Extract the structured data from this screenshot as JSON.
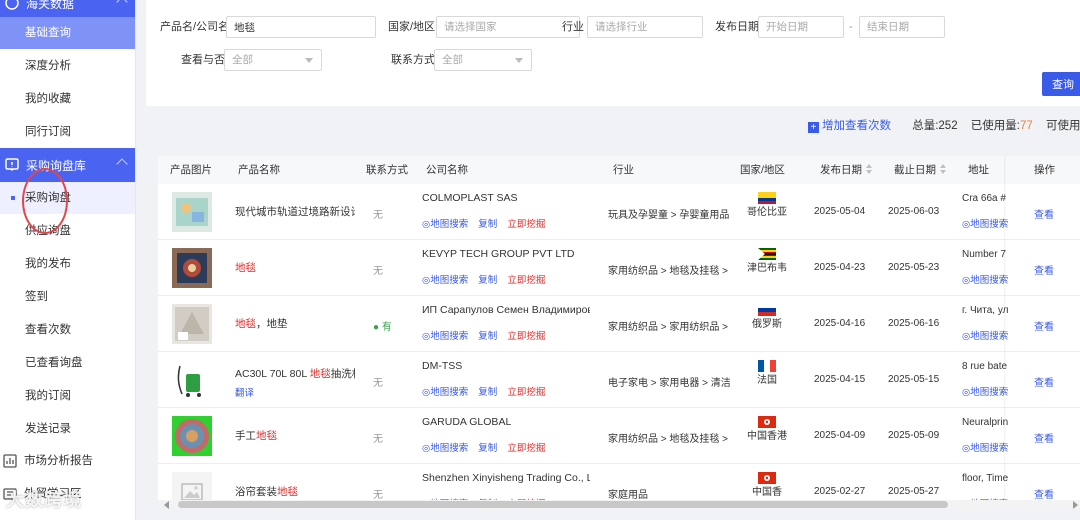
{
  "sidebar": {
    "group_top": "海关数据",
    "items_top": [
      {
        "label": "基础查询",
        "state": "active"
      },
      {
        "label": "深度分析"
      },
      {
        "label": "我的收藏"
      },
      {
        "label": "同行订阅"
      }
    ],
    "group_procurement": "采购询盘库",
    "items_procurement": [
      {
        "label": "采购询盘",
        "state": "current"
      },
      {
        "label": "供应询盘"
      },
      {
        "label": "我的发布"
      },
      {
        "label": "签到"
      },
      {
        "label": "查看次数"
      },
      {
        "label": "已查看询盘"
      },
      {
        "label": "我的订阅"
      },
      {
        "label": "发送记录"
      }
    ],
    "main_market_report": "市场分析报告",
    "main_learning": "外贸学习区"
  },
  "filters": {
    "product_label": "产品名/公司名",
    "product_value": "地毯",
    "country_label": "国家/地区",
    "country_placeholder": "请选择国家",
    "industry_label": "行业",
    "industry_placeholder": "请选择行业",
    "date_label": "发布日期",
    "start_placeholder": "开始日期",
    "date_sep": "-",
    "end_placeholder": "结束日期",
    "viewed_label": "查看与否",
    "viewed_value": "全部",
    "contact_label": "联系方式",
    "contact_value": "全部",
    "query_button": "查询"
  },
  "stats": {
    "add_views": "增加查看次数",
    "total_label": "总量:",
    "total_value": "252",
    "used_label": "已使用量:",
    "used_value": "77",
    "available_label": "可使用量:"
  },
  "table": {
    "headers": {
      "image": "产品图片",
      "name": "产品名称",
      "contact": "联系方式",
      "company": "公司名称",
      "industry": "行业",
      "country": "国家/地区",
      "publish_date": "发布日期",
      "deadline": "截止日期",
      "address": "地址",
      "ops": "操作"
    },
    "action_labels": {
      "map": "◎地图搜索",
      "copy": "复制",
      "dig": "立即挖掘",
      "view": "查看"
    },
    "rows": [
      {
        "name_pre": "现代城市轨道过境路新设计",
        "name_hl": "",
        "name_post": "",
        "contact": "无",
        "company": "COLMOPLAST SAS",
        "industry": "玩具及孕婴童 > 孕婴童用品",
        "country": "哥伦比亚",
        "publish": "2025-05-04",
        "deadline": "2025-06-03",
        "address": "Cra 66a #",
        "thumb": "toy"
      },
      {
        "name_pre": "",
        "name_hl": "地毯",
        "name_post": "",
        "contact": "无",
        "company": "KEVYP TECH GROUP PVT LTD",
        "industry": "家用纺织品 > 地毯及挂毯 > 地",
        "country": "津巴布韦",
        "publish": "2025-04-23",
        "deadline": "2025-05-23",
        "address": "Number 7",
        "thumb": "rug"
      },
      {
        "name_pre": "",
        "name_hl": "地毯",
        "name_post": "，地垫",
        "contact": "有",
        "company": "ИП Сарапулов Семен Владимирович",
        "industry": "家用纺织品 > 家用纺织品 > 地",
        "country": "俄罗斯",
        "publish": "2025-04-16",
        "deadline": "2025-06-16",
        "address": "г. Чита, ул",
        "thumb": "mat"
      },
      {
        "name_pre": "AC30L 70L 80L ",
        "name_hl": "地毯",
        "name_post": "抽洗机",
        "translate": "翻译",
        "contact": "无",
        "company": "DM-TSS",
        "industry": "电子家电 > 家用电器 > 清洁",
        "country": "法国",
        "publish": "2025-04-15",
        "deadline": "2025-05-15",
        "address": "8 rue bate",
        "thumb": "vacuum"
      },
      {
        "name_pre": "手工",
        "name_hl": "地毯",
        "name_post": "",
        "contact": "无",
        "company": "GARUDA GLOBAL",
        "industry": "家用纺织品 > 地毯及挂毯 > 地",
        "country": "中国香港",
        "publish": "2025-04-09",
        "deadline": "2025-05-09",
        "address": "Neuralprin",
        "thumb": "round"
      },
      {
        "name_pre": "浴帘套装",
        "name_hl": "地毯",
        "name_post": "",
        "contact": "无",
        "company": "Shenzhen Xinyisheng Trading Co., Ltd.",
        "industry": "家庭用品",
        "country": "中国香",
        "publish": "2025-02-27",
        "deadline": "2025-05-27",
        "address": "floor, Time",
        "thumb": "placeholder"
      }
    ]
  },
  "watermark": "大数跨境",
  "colors": {
    "accent": "#3a5ae8",
    "sidebar_active": "#4a63f0",
    "highlight": "#e02b2b",
    "used": "#e8833a"
  }
}
